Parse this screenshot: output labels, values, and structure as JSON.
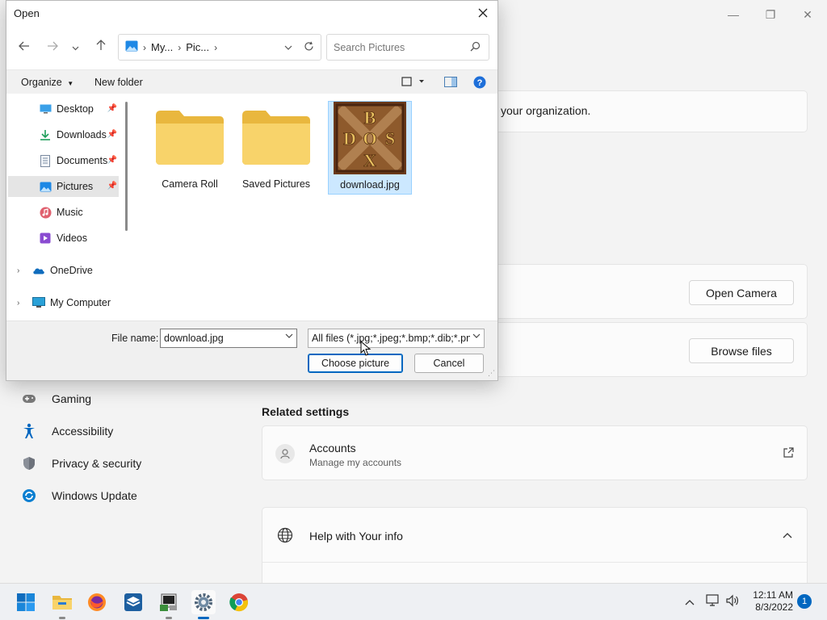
{
  "settings": {
    "window_controls": {
      "minimize": "—",
      "restore": "❐",
      "close": "✕"
    },
    "org_text": "your organization.",
    "camera_button": "Open Camera",
    "browse_button": "Browse files",
    "nav": [
      {
        "label": "Gaming",
        "icon": "gamepad-icon"
      },
      {
        "label": "Accessibility",
        "icon": "accessibility-icon"
      },
      {
        "label": "Privacy & security",
        "icon": "shield-icon"
      },
      {
        "label": "Windows Update",
        "icon": "update-icon"
      }
    ],
    "related_title": "Related settings",
    "accounts": {
      "title": "Accounts",
      "subtitle": "Manage my accounts"
    },
    "help": {
      "title": "Help with Your info"
    }
  },
  "dialog": {
    "title": "Open",
    "breadcrumb": [
      "My...",
      "Pic..."
    ],
    "search_placeholder": "Search Pictures",
    "organize": "Organize",
    "new_folder": "New folder",
    "tree": [
      {
        "label": "Desktop",
        "icon": "desktop-icon",
        "pinned": true
      },
      {
        "label": "Downloads",
        "icon": "download-icon",
        "pinned": true
      },
      {
        "label": "Documents",
        "icon": "document-icon",
        "pinned": true
      },
      {
        "label": "Pictures",
        "icon": "pictures-icon",
        "pinned": true,
        "selected": true
      },
      {
        "label": "Music",
        "icon": "music-icon"
      },
      {
        "label": "Videos",
        "icon": "video-icon"
      },
      {
        "label": "OneDrive",
        "icon": "cloud-icon",
        "expandable": true
      },
      {
        "label": "My Computer",
        "icon": "computer-icon",
        "expandable": true
      }
    ],
    "files": [
      {
        "name": "Camera Roll",
        "type": "folder"
      },
      {
        "name": "Saved Pictures",
        "type": "folder"
      },
      {
        "name": "download.jpg",
        "type": "image",
        "selected": true,
        "thumb_letters": [
          "B",
          "D",
          "O",
          "S",
          "X"
        ]
      }
    ],
    "file_name_label": "File name:",
    "file_name_value": "download.jpg",
    "file_type_value": "All files (*.jpg;*.jpeg;*.bmp;*.dib;*.png",
    "choose_button": "Choose picture",
    "cancel_button": "Cancel"
  },
  "taskbar": {
    "apps": [
      "windows-start-icon",
      "file-explorer-icon",
      "firefox-icon",
      "virtualbox-icon",
      "terminal-app-icon",
      "settings-icon",
      "chrome-icon"
    ],
    "time": "12:11 AM",
    "date": "8/3/2022",
    "notifications": "1"
  },
  "colors": {
    "accent": "#0067c0",
    "selection": "#cce8ff",
    "folder": "#f8d36a"
  }
}
